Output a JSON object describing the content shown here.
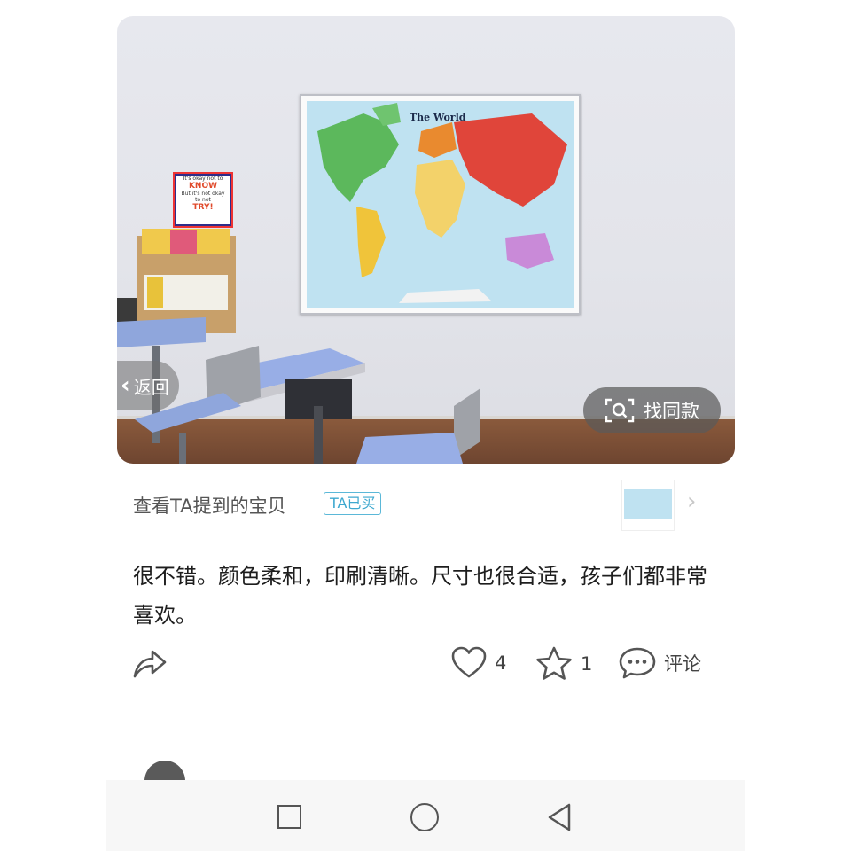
{
  "photo": {
    "back_label": "返回",
    "find_similar_label": "找同款",
    "map_title": "The World",
    "poster_lines": [
      "It's okay not to",
      "KNOW",
      "But it's not okay",
      "to not",
      "TRY!"
    ]
  },
  "product": {
    "view_label": "查看TA提到的宝贝",
    "badge": "TA已买"
  },
  "review": {
    "text": "很不错。颜色柔和，印刷清晰。尺寸也很合适，孩子们都非常喜欢。"
  },
  "actions": {
    "like_count": "4",
    "favorite_count": "1",
    "comment_label": "评论"
  },
  "icons": [
    "chevron-left-icon",
    "image-search-icon",
    "chevron-right-icon",
    "share-icon",
    "heart-icon",
    "star-icon",
    "comment-icon",
    "recent-apps-icon",
    "home-icon",
    "back-triangle-icon"
  ]
}
